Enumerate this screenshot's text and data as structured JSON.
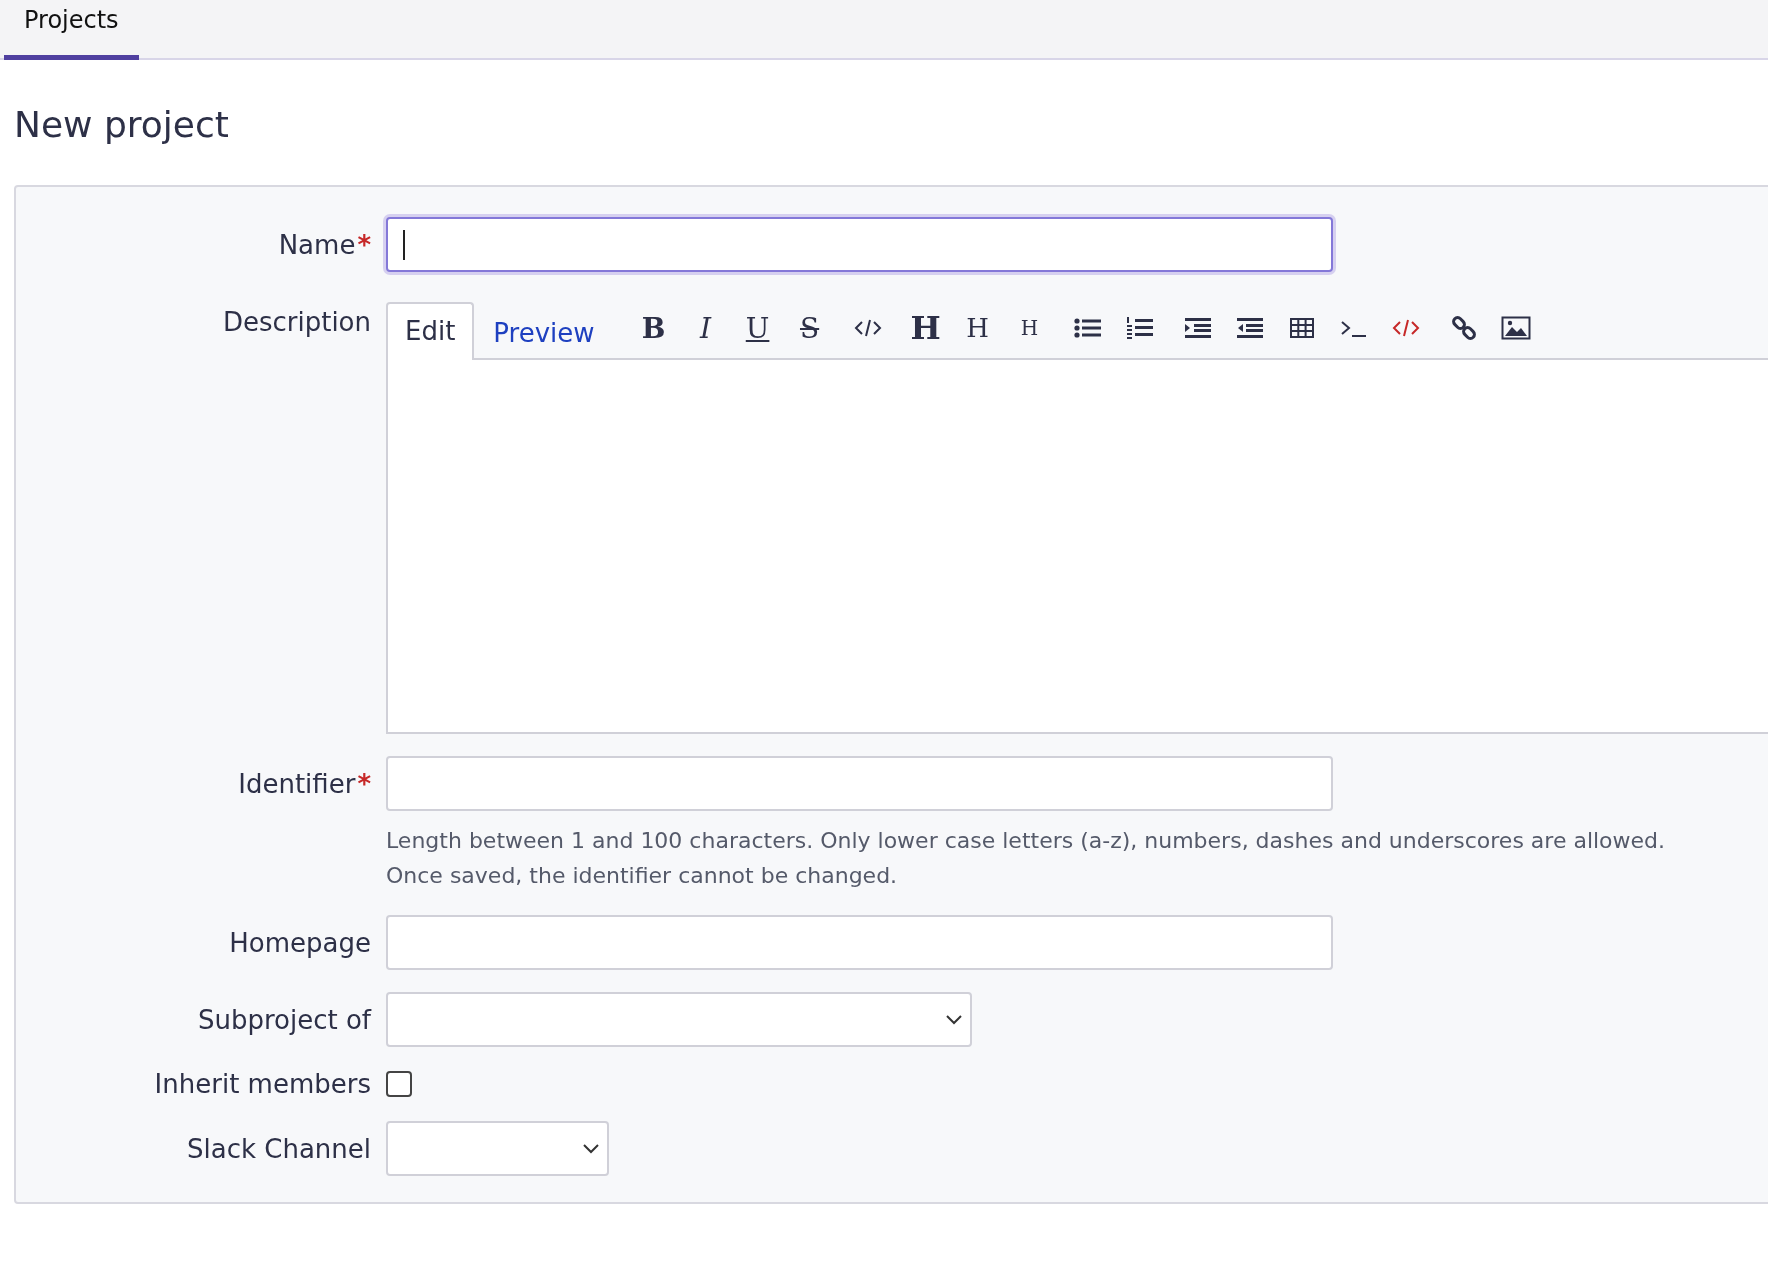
{
  "tabs": [
    {
      "label": "Projects",
      "selected": true
    }
  ],
  "title": "New project",
  "form": {
    "fields": [
      {
        "kind": "text",
        "label": "Name",
        "mark": "*",
        "focused": true
      },
      {
        "kind": "editor",
        "label": "Description",
        "tabs": [
          {
            "label": "Edit",
            "selected": true
          },
          {
            "label": "Preview",
            "selected": false
          }
        ],
        "toolbar": [
          {
            "kind": "bold",
            "label": "B"
          },
          {
            "kind": "italic",
            "label": "I"
          },
          {
            "kind": "underline",
            "label": "U"
          },
          {
            "kind": "strike",
            "label": "S"
          },
          {
            "kind": "code"
          },
          {
            "kind": "h1",
            "label": "H"
          },
          {
            "kind": "h2",
            "label": "H"
          },
          {
            "kind": "h3",
            "label": "H"
          },
          {
            "kind": "ul"
          },
          {
            "kind": "ol"
          },
          {
            "kind": "indent"
          },
          {
            "kind": "outdent"
          },
          {
            "kind": "table"
          },
          {
            "kind": "pre"
          },
          {
            "kind": "html"
          },
          {
            "kind": "link"
          },
          {
            "kind": "image"
          }
        ]
      },
      {
        "kind": "text",
        "label": "Identifier",
        "mark": "*",
        "focused": false,
        "help": [
          "Length between 1 and 100 characters. Only lower case letters (a-z), numbers, dashes and underscores are allowed.",
          "Once saved, the identifier cannot be changed."
        ]
      },
      {
        "kind": "text",
        "label": "Homepage",
        "focused": false
      },
      {
        "kind": "select",
        "label": "Subproject of"
      },
      {
        "kind": "checkbox",
        "label": "Inherit members",
        "checked": false
      },
      {
        "kind": "short-select",
        "label": "Slack Channel"
      }
    ]
  }
}
